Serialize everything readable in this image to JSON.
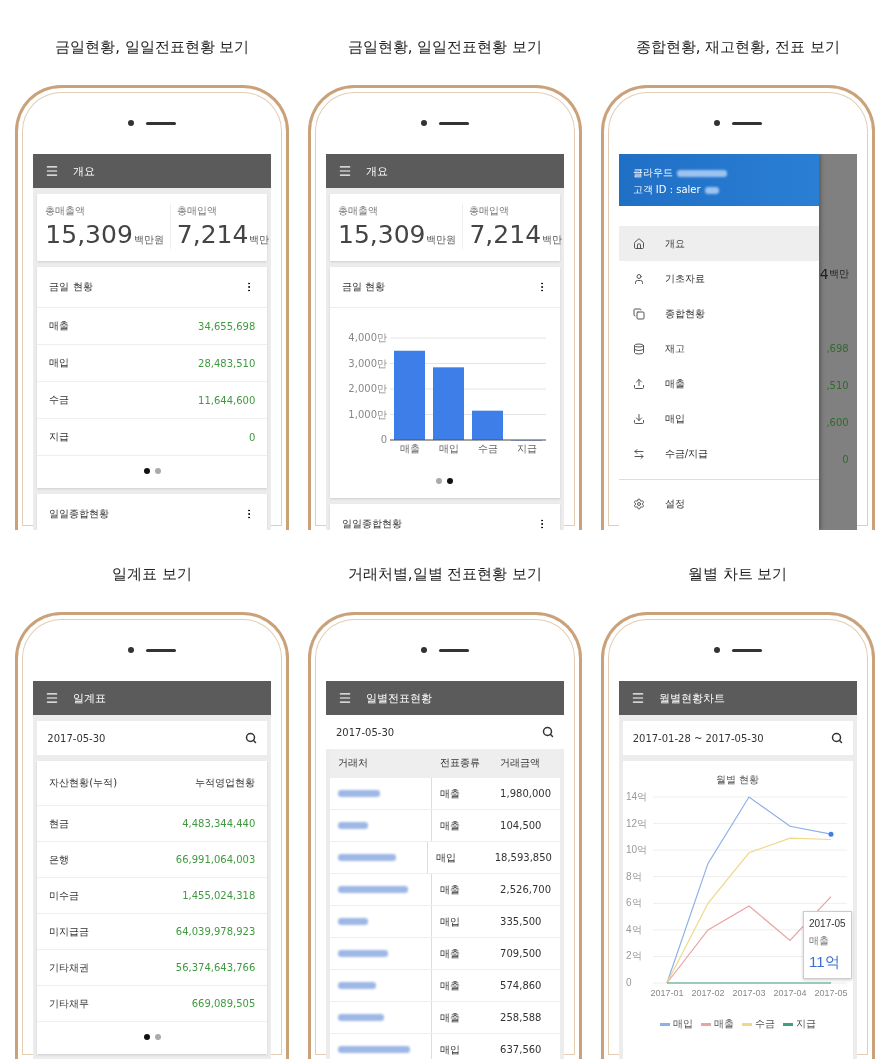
{
  "panels": [
    {
      "caption": "금일현황, 일일전표현황 보기",
      "kind": "overview",
      "title": "개요",
      "summary": [
        {
          "label": "총매출액",
          "value": "15,309",
          "unit": "백만원"
        },
        {
          "label": "총매입액",
          "value": "7,214",
          "unit": "백만"
        }
      ],
      "today": {
        "title": "금일 현황",
        "kind": "list",
        "rows": [
          {
            "label": "매출",
            "value": "34,655,698"
          },
          {
            "label": "매입",
            "value": "28,483,510"
          },
          {
            "label": "수금",
            "value": "11,644,600"
          },
          {
            "label": "지급",
            "value": "0"
          }
        ]
      },
      "pager": [
        {
          "selected": true
        },
        {
          "selected": false
        }
      ],
      "next_card": {
        "title": "일일종합현황"
      }
    },
    {
      "caption": "금일현황, 일일전표현황 보기",
      "kind": "overview",
      "title": "개요",
      "summary": [
        {
          "label": "총매출액",
          "value": "15,309",
          "unit": "백만원"
        },
        {
          "label": "총매입액",
          "value": "7,214",
          "unit": "백만"
        }
      ],
      "today": {
        "title": "금일 현황",
        "kind": "chart",
        "chart_data": {
          "type": "bar",
          "categories": [
            "매출",
            "매입",
            "수금",
            "지급"
          ],
          "values": [
            3500,
            2850,
            1150,
            0
          ],
          "grid": true,
          "ylim": [
            0,
            4000
          ],
          "yticks": [
            {
              "value": 0,
              "label": "0"
            },
            {
              "value": 1000,
              "label": "1,000만"
            },
            {
              "value": 2000,
              "label": "2,000만"
            },
            {
              "value": 3000,
              "label": "3,000만"
            },
            {
              "value": 4000,
              "label": "4,000만"
            }
          ]
        }
      },
      "pager": [
        {
          "selected": false
        },
        {
          "selected": true
        }
      ],
      "next_card": {
        "title": "일일종합현황"
      }
    },
    {
      "caption": "종합현황, 재고현황, 전표 보기",
      "kind": "drawer",
      "account": {
        "line_1": "클라우드",
        "line_2": "고객 ID : saler"
      },
      "menu": [
        {
          "label": "개요",
          "selected": true
        },
        {
          "label": "기초자료",
          "selected": false
        },
        {
          "label": "종합현황",
          "selected": false
        },
        {
          "label": "재고",
          "selected": false
        },
        {
          "label": "매출",
          "selected": false
        },
        {
          "label": "매입",
          "selected": false
        },
        {
          "label": "수금/지급",
          "selected": false
        }
      ],
      "settings": {
        "label": "설정"
      },
      "behind": {
        "summary_value": "4",
        "summary_unit": "백만",
        "values": [
          ",698",
          ",510",
          ",600",
          "0"
        ]
      }
    },
    {
      "caption": "일계표 보기",
      "kind": "ledger",
      "title": "일계표",
      "search": {
        "value": "2017-05-30"
      },
      "columns": [
        "자산현황(누적)",
        "누적영업현황"
      ],
      "rows": [
        {
          "label": "현금",
          "value": "4,483,344,440"
        },
        {
          "label": "은행",
          "value": "66,991,064,003"
        },
        {
          "label": "미수금",
          "value": "1,455,024,318"
        },
        {
          "label": "미지급금",
          "value": "64,039,978,923"
        },
        {
          "label": "기타채권",
          "value": "56,374,643,766"
        },
        {
          "label": "기타채무",
          "value": "669,089,505"
        }
      ],
      "pager": [
        {
          "selected": true
        },
        {
          "selected": false
        }
      ]
    },
    {
      "caption": "거래처별,일별 전표현황 보기",
      "kind": "vouchers",
      "title": "일별전표현황",
      "search": {
        "value": "2017-05-30"
      },
      "columns": [
        "거래처",
        "전표종류",
        "거래금액"
      ],
      "rows": [
        {
          "type": "매출",
          "amount": "1,980,000"
        },
        {
          "type": "매출",
          "amount": "104,500"
        },
        {
          "type": "매입",
          "amount": "18,593,850"
        },
        {
          "type": "매출",
          "amount": "2,526,700"
        },
        {
          "type": "매입",
          "amount": "335,500"
        },
        {
          "type": "매출",
          "amount": "709,500"
        },
        {
          "type": "매출",
          "amount": "574,860"
        },
        {
          "type": "매출",
          "amount": "258,588"
        },
        {
          "type": "매입",
          "amount": "637,560"
        }
      ]
    },
    {
      "caption": "월별 차트 보기",
      "kind": "monthly",
      "title": "월별현황차트",
      "search": {
        "value": "2017-01-28 ~ 2017-05-30"
      },
      "chart_data": {
        "type": "line",
        "title": "월별 현황",
        "categories": [
          "2017-01",
          "2017-02",
          "2017-03",
          "2017-04",
          "2017-05"
        ],
        "grid": true,
        "legend": true,
        "ylim": [
          0,
          14
        ],
        "yticks": [
          {
            "value": 0,
            "label": "0"
          },
          {
            "value": 2,
            "label": "2억"
          },
          {
            "value": 4,
            "label": "4억"
          },
          {
            "value": 6,
            "label": "6억"
          },
          {
            "value": 8,
            "label": "8억"
          },
          {
            "value": 10,
            "label": "10억"
          },
          {
            "value": 12,
            "label": "12억"
          },
          {
            "value": 14,
            "label": "14억"
          }
        ],
        "series": [
          {
            "name": "매입",
            "color": "#8fb0e6",
            "values": [
              0,
              9,
              14,
              11.8,
              11.2
            ]
          },
          {
            "name": "매출",
            "color": "#e8a3a3",
            "values": [
              0,
              4,
              5.8,
              3.2,
              6.5
            ]
          },
          {
            "name": "수금",
            "color": "#f0d88a",
            "values": [
              0,
              6,
              9.8,
              10.9,
              10.8
            ]
          },
          {
            "name": "지급",
            "color": "#3f9f7a",
            "values": [
              0,
              0,
              0,
              0,
              0
            ]
          }
        ]
      },
      "tooltip": {
        "title": "2017-05",
        "label": "매출",
        "value": "11억"
      }
    }
  ]
}
